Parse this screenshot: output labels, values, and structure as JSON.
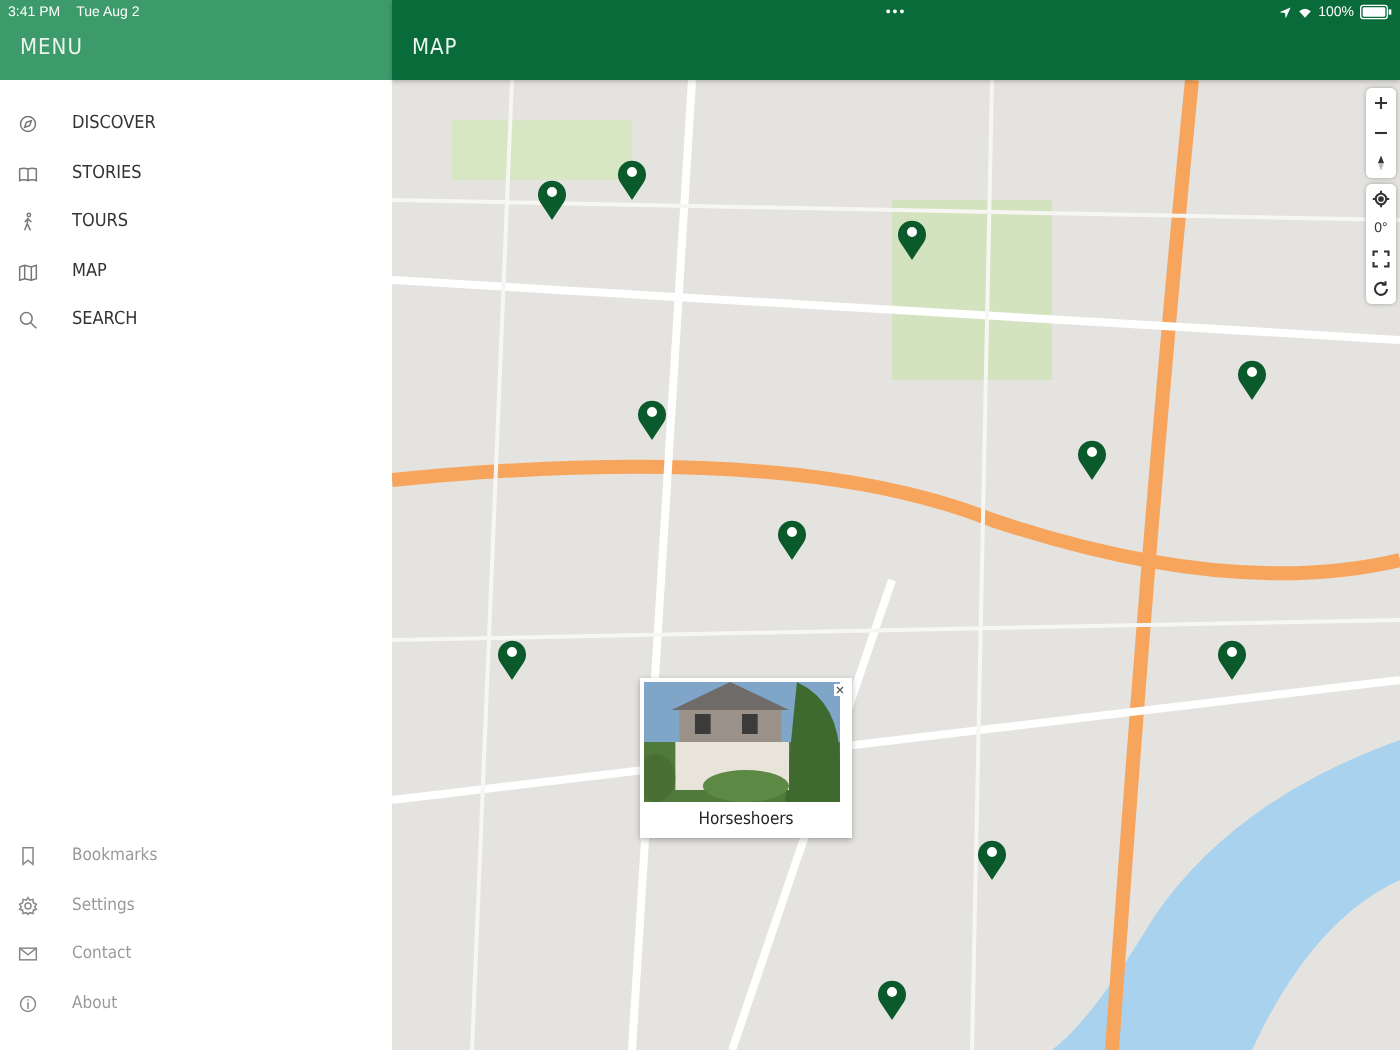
{
  "status_bar": {
    "time": "3:41 PM",
    "date": "Tue Aug 2",
    "more": "•••",
    "battery": "100%"
  },
  "sidebar": {
    "title": "MENU",
    "items": [
      {
        "label": "DISCOVER"
      },
      {
        "label": "STORIES"
      },
      {
        "label": "TOURS"
      },
      {
        "label": "MAP"
      },
      {
        "label": "SEARCH"
      }
    ],
    "secondary_items": [
      {
        "label": "Bookmarks"
      },
      {
        "label": "Settings"
      },
      {
        "label": "Contact"
      },
      {
        "label": "About"
      }
    ]
  },
  "map": {
    "title": "MAP",
    "controls": [
      [
        {
          "kind": "zoom-in"
        },
        {
          "kind": "zoom-out"
        },
        {
          "kind": "compass"
        }
      ],
      [
        {
          "kind": "locate"
        },
        {
          "kind": "bearing",
          "label": "0°"
        },
        {
          "kind": "fullscreen"
        },
        {
          "kind": "reset"
        }
      ]
    ],
    "popup": {
      "title": "Horseshoers"
    }
  }
}
